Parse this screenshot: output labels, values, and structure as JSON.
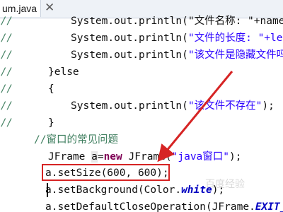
{
  "tab": {
    "label": "um.java",
    "close_glyph": "✕"
  },
  "lines": [
    {
      "gutter": "//",
      "text": "System.out.println(\"文件名称: \"+name);"
    },
    {
      "gutter": "//",
      "text_parts": [
        "System.out.println(",
        "\"文件的长度: \"+length",
        ");"
      ]
    },
    {
      "gutter": "//",
      "text_parts": [
        "System.out.println(",
        "\"该文件是隐藏文件吗？\"+",
        ""
      ]
    },
    {
      "gutter": "//",
      "text": "}else"
    },
    {
      "gutter": "//",
      "text": "{"
    },
    {
      "gutter": "//",
      "text_parts": [
        "System.out.println(",
        "\"该文件不存在\"",
        ");"
      ]
    },
    {
      "gutter": "//",
      "text": "}"
    },
    {
      "comment": "//窗口的常见问题"
    },
    {
      "parts": [
        "JFrame ",
        "a",
        "=",
        "new",
        " JFrame(",
        "\"java窗口\"",
        ");"
      ]
    },
    {
      "text": "a.setSize(600, 600);"
    },
    {
      "parts": [
        "a.setBackground(Color.",
        "white",
        ");"
      ]
    },
    {
      "parts": [
        "a.setDefaultCloseOperation(JFrame.",
        "EXIT_C"
      ]
    }
  ],
  "watermark": "百度经验",
  "colors": {
    "annotation": "#d62424",
    "keyword": "#7f0055",
    "string": "#2a00ff",
    "comment": "#3f7f5f"
  }
}
